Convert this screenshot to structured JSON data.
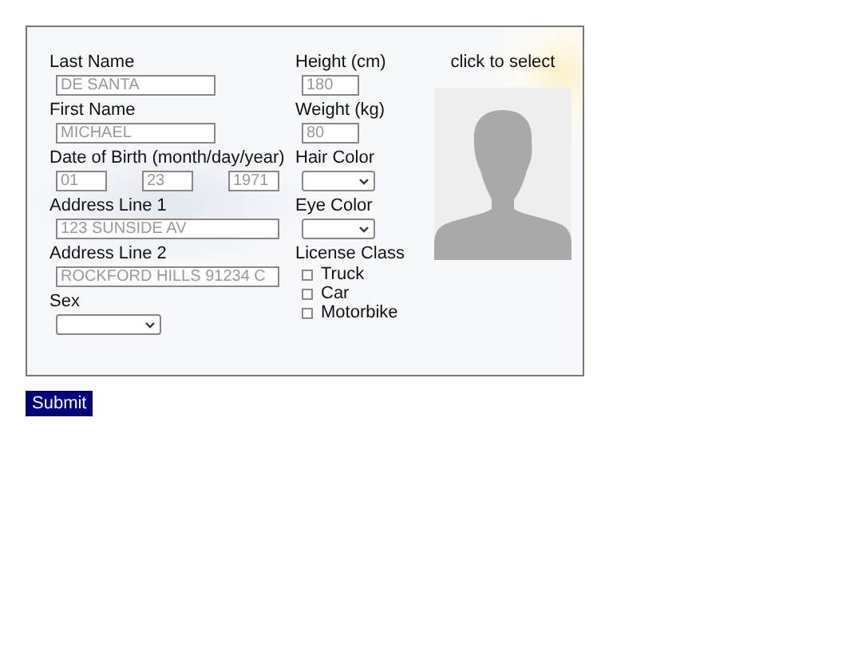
{
  "left_fields": [
    {
      "kind": "short_text",
      "label": "Last Name",
      "inputs": [
        {
          "placeholder": "DE SANTA"
        }
      ]
    },
    {
      "kind": "short_text",
      "label": "First Name",
      "inputs": [
        {
          "placeholder": "MICHAEL"
        }
      ]
    },
    {
      "kind": "date",
      "label": "Date of Birth (month/day/year)",
      "inputs": [
        {
          "placeholder": "01"
        },
        {
          "placeholder": "23"
        },
        {
          "placeholder": "1971"
        }
      ]
    },
    {
      "kind": "long_text",
      "label": "Address Line 1",
      "inputs": [
        {
          "placeholder": "123 SUNSIDE AV"
        }
      ]
    },
    {
      "kind": "long_text",
      "label": "Address Line 2",
      "inputs": [
        {
          "placeholder": "ROCKFORD HILLS 91234 C"
        }
      ]
    },
    {
      "kind": "select",
      "label": "Sex"
    }
  ],
  "right_fields": [
    {
      "kind": "number",
      "label": "Height (cm)",
      "inputs": [
        {
          "placeholder": "180"
        }
      ]
    },
    {
      "kind": "number",
      "label": "Weight (kg)",
      "inputs": [
        {
          "placeholder": "80"
        }
      ]
    },
    {
      "kind": "select",
      "label": "Hair Color"
    },
    {
      "kind": "select",
      "label": "Eye Color"
    },
    {
      "kind": "checkboxes",
      "label": "License Class",
      "options": [
        {
          "label": "Truck",
          "checked": false
        },
        {
          "label": "Car",
          "checked": false
        },
        {
          "label": "Motorbike",
          "checked": false
        }
      ]
    }
  ],
  "photo": {
    "caption": "click to select"
  },
  "submit": "Submit"
}
